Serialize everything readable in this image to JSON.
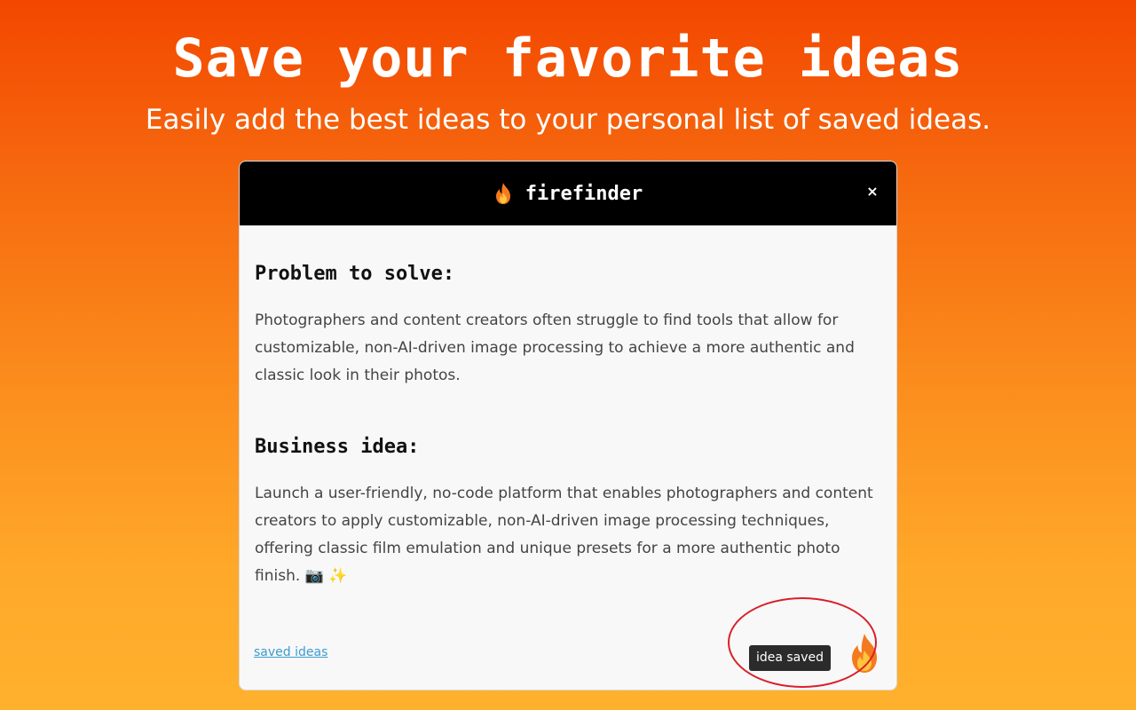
{
  "hero": {
    "title": "Save your favorite ideas",
    "subtitle": "Easily add the best ideas to your personal list of saved ideas."
  },
  "popup": {
    "brand": "firefinder",
    "brand_icon": "fire-icon",
    "close_label": "×",
    "sections": [
      {
        "heading": "Problem to solve:",
        "text": "Photographers and content creators often struggle to find tools that allow for customizable, non-AI-driven image processing to achieve a more authentic and classic look in their photos."
      },
      {
        "heading": "Business idea:",
        "text": "Launch a user-friendly, no-code platform that enables photographers and content creators to apply customizable, non-AI-driven image processing techniques, offering classic film emulation and unique presets for a more authentic photo finish. 📷 ✨"
      }
    ],
    "footer": {
      "saved_link": "saved ideas",
      "toast": "idea saved",
      "save_icon": "fire-icon"
    }
  },
  "colors": {
    "gradient_top": "#f34700",
    "gradient_bottom": "#ffb12d",
    "header_bg": "#000000",
    "link": "#3d9bd0",
    "toast_bg": "#2b2b2b",
    "highlight": "#d8202a"
  }
}
